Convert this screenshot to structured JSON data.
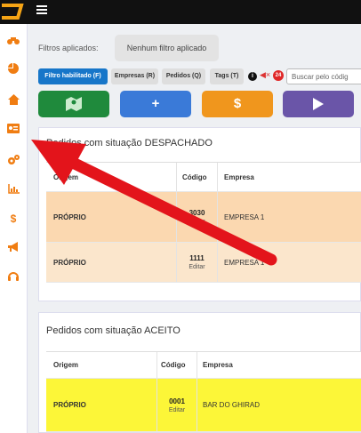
{
  "filters": {
    "label": "Filtros aplicados:",
    "applied": "Nenhum filtro aplicado"
  },
  "chips": {
    "habilitado": "Filtro habilitado (F)",
    "empresas": "Empresas (R)",
    "pedidos": "Pedidos (Q)",
    "tags": "Tags (T)"
  },
  "search": {
    "placeholder": "Buscar pelo códig"
  },
  "actions": {
    "add": "+",
    "money": "$"
  },
  "despachado": {
    "title": "Pedidos com situação DESPACHADO",
    "headers": {
      "origem": "Origem",
      "codigo": "Código",
      "empresa": "Empresa"
    },
    "rows": [
      {
        "origem": "PRÓPRIO",
        "codigo": "3030",
        "edit": "Editar",
        "empresa": "EMPRESA 1",
        "bg": "#fbd8b0"
      },
      {
        "origem": "PRÓPRIO",
        "codigo": "1111",
        "edit": "Editar",
        "empresa": "EMPRESA 1",
        "bg": "#fbe6cc"
      }
    ]
  },
  "aceito": {
    "title": "Pedidos com situação ACEITO",
    "headers": {
      "origem": "Origem",
      "codigo": "Código",
      "empresa": "Empresa"
    },
    "rows": [
      {
        "origem": "PRÓPRIO",
        "codigo": "0001",
        "edit": "Editar",
        "empresa": "BAR DO GHIRAD",
        "bg": "#fcf638"
      }
    ]
  },
  "colors": {
    "accent_orange": "#f07d12",
    "topbar": "#111111",
    "arrow": "#e3141b"
  },
  "sidebar_icons": [
    "motorcycle-icon",
    "pie-chart-icon",
    "home-icon",
    "id-card-icon",
    "gears-icon",
    "bar-chart-icon",
    "dollar-icon",
    "megaphone-icon",
    "headset-icon"
  ]
}
